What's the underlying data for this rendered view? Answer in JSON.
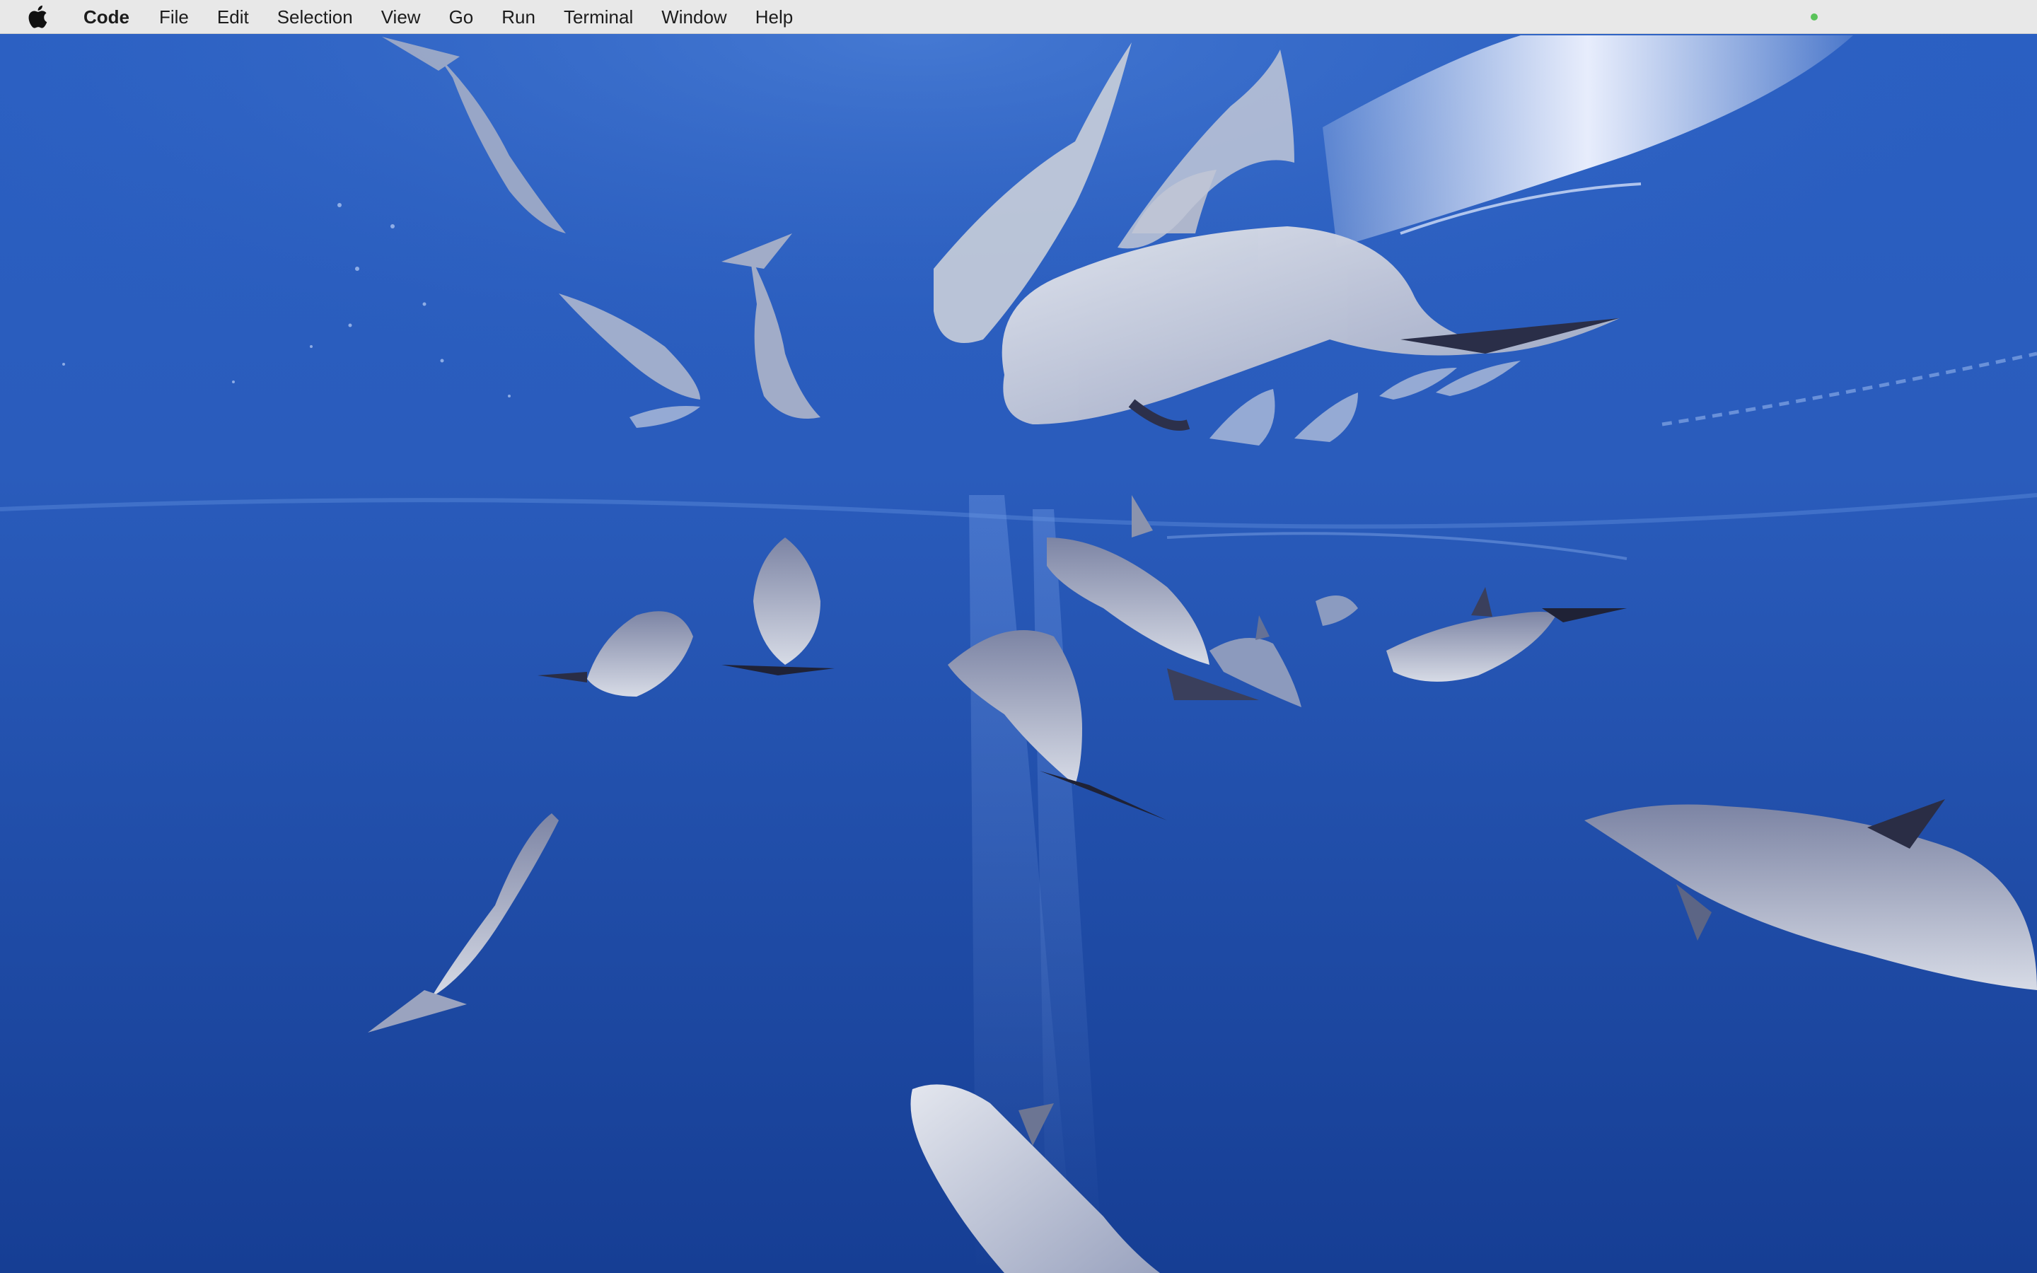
{
  "menubar": {
    "apple_icon": "apple-logo-icon",
    "app_name": "Code",
    "items": [
      "File",
      "Edit",
      "Selection",
      "View",
      "Go",
      "Run",
      "Terminal",
      "Window",
      "Help"
    ],
    "status_indicator_color": "#5ac35a",
    "background_color": "#e8e8e8",
    "text_color": "#1c1c1c"
  },
  "wallpaper": {
    "subject": "underwater-dolphins",
    "water_color_top": "#2e63c4",
    "water_color_bottom": "#163f96",
    "dolphin_color": "#b9bfd2"
  }
}
